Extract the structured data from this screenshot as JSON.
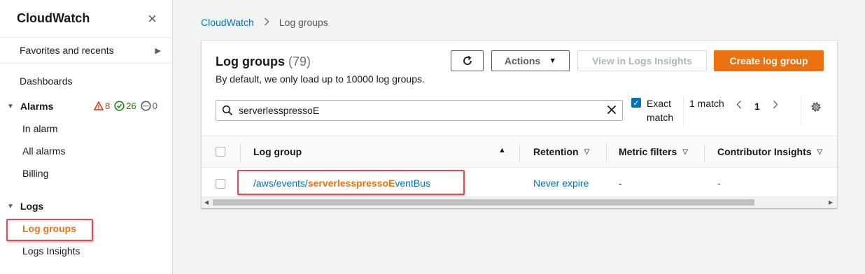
{
  "sidebar": {
    "title": "CloudWatch",
    "close_icon": "×",
    "favorites": "Favorites and recents",
    "dashboards": "Dashboards",
    "alarms": {
      "label": "Alarms",
      "in_alarm_count": "8",
      "ok_count": "26",
      "insufficient_count": "0",
      "items": [
        "In alarm",
        "All alarms",
        "Billing"
      ]
    },
    "logs": {
      "label": "Logs",
      "items": [
        "Log groups",
        "Logs Insights"
      ]
    }
  },
  "breadcrumb": {
    "root": "CloudWatch",
    "current": "Log groups"
  },
  "panel": {
    "title": "Log groups",
    "count": "(79)",
    "description": "By default, we only load up to 10000 log groups.",
    "actions_label": "Actions",
    "insights_label": "View in Logs Insights",
    "create_label": "Create log group",
    "search_value": "serverlesspressoE",
    "exact_label": "Exact match",
    "match_text": "1 match",
    "page": "1"
  },
  "table": {
    "headers": [
      "Log group",
      "Retention",
      "Metric filters",
      "Contributor Insights"
    ],
    "rows": [
      {
        "log_group_prefix": "/aws/events/",
        "log_group_match": "serverlesspressoE",
        "log_group_suffix": "ventBus",
        "retention": "Never expire",
        "metric_filters": "-",
        "contributor_insights": "-"
      }
    ]
  },
  "colors": {
    "accent": "#ec7211",
    "link": "#0073bb",
    "alarm": "#d13212",
    "ok": "#1d8102",
    "highlight_box": "#e8484f"
  }
}
